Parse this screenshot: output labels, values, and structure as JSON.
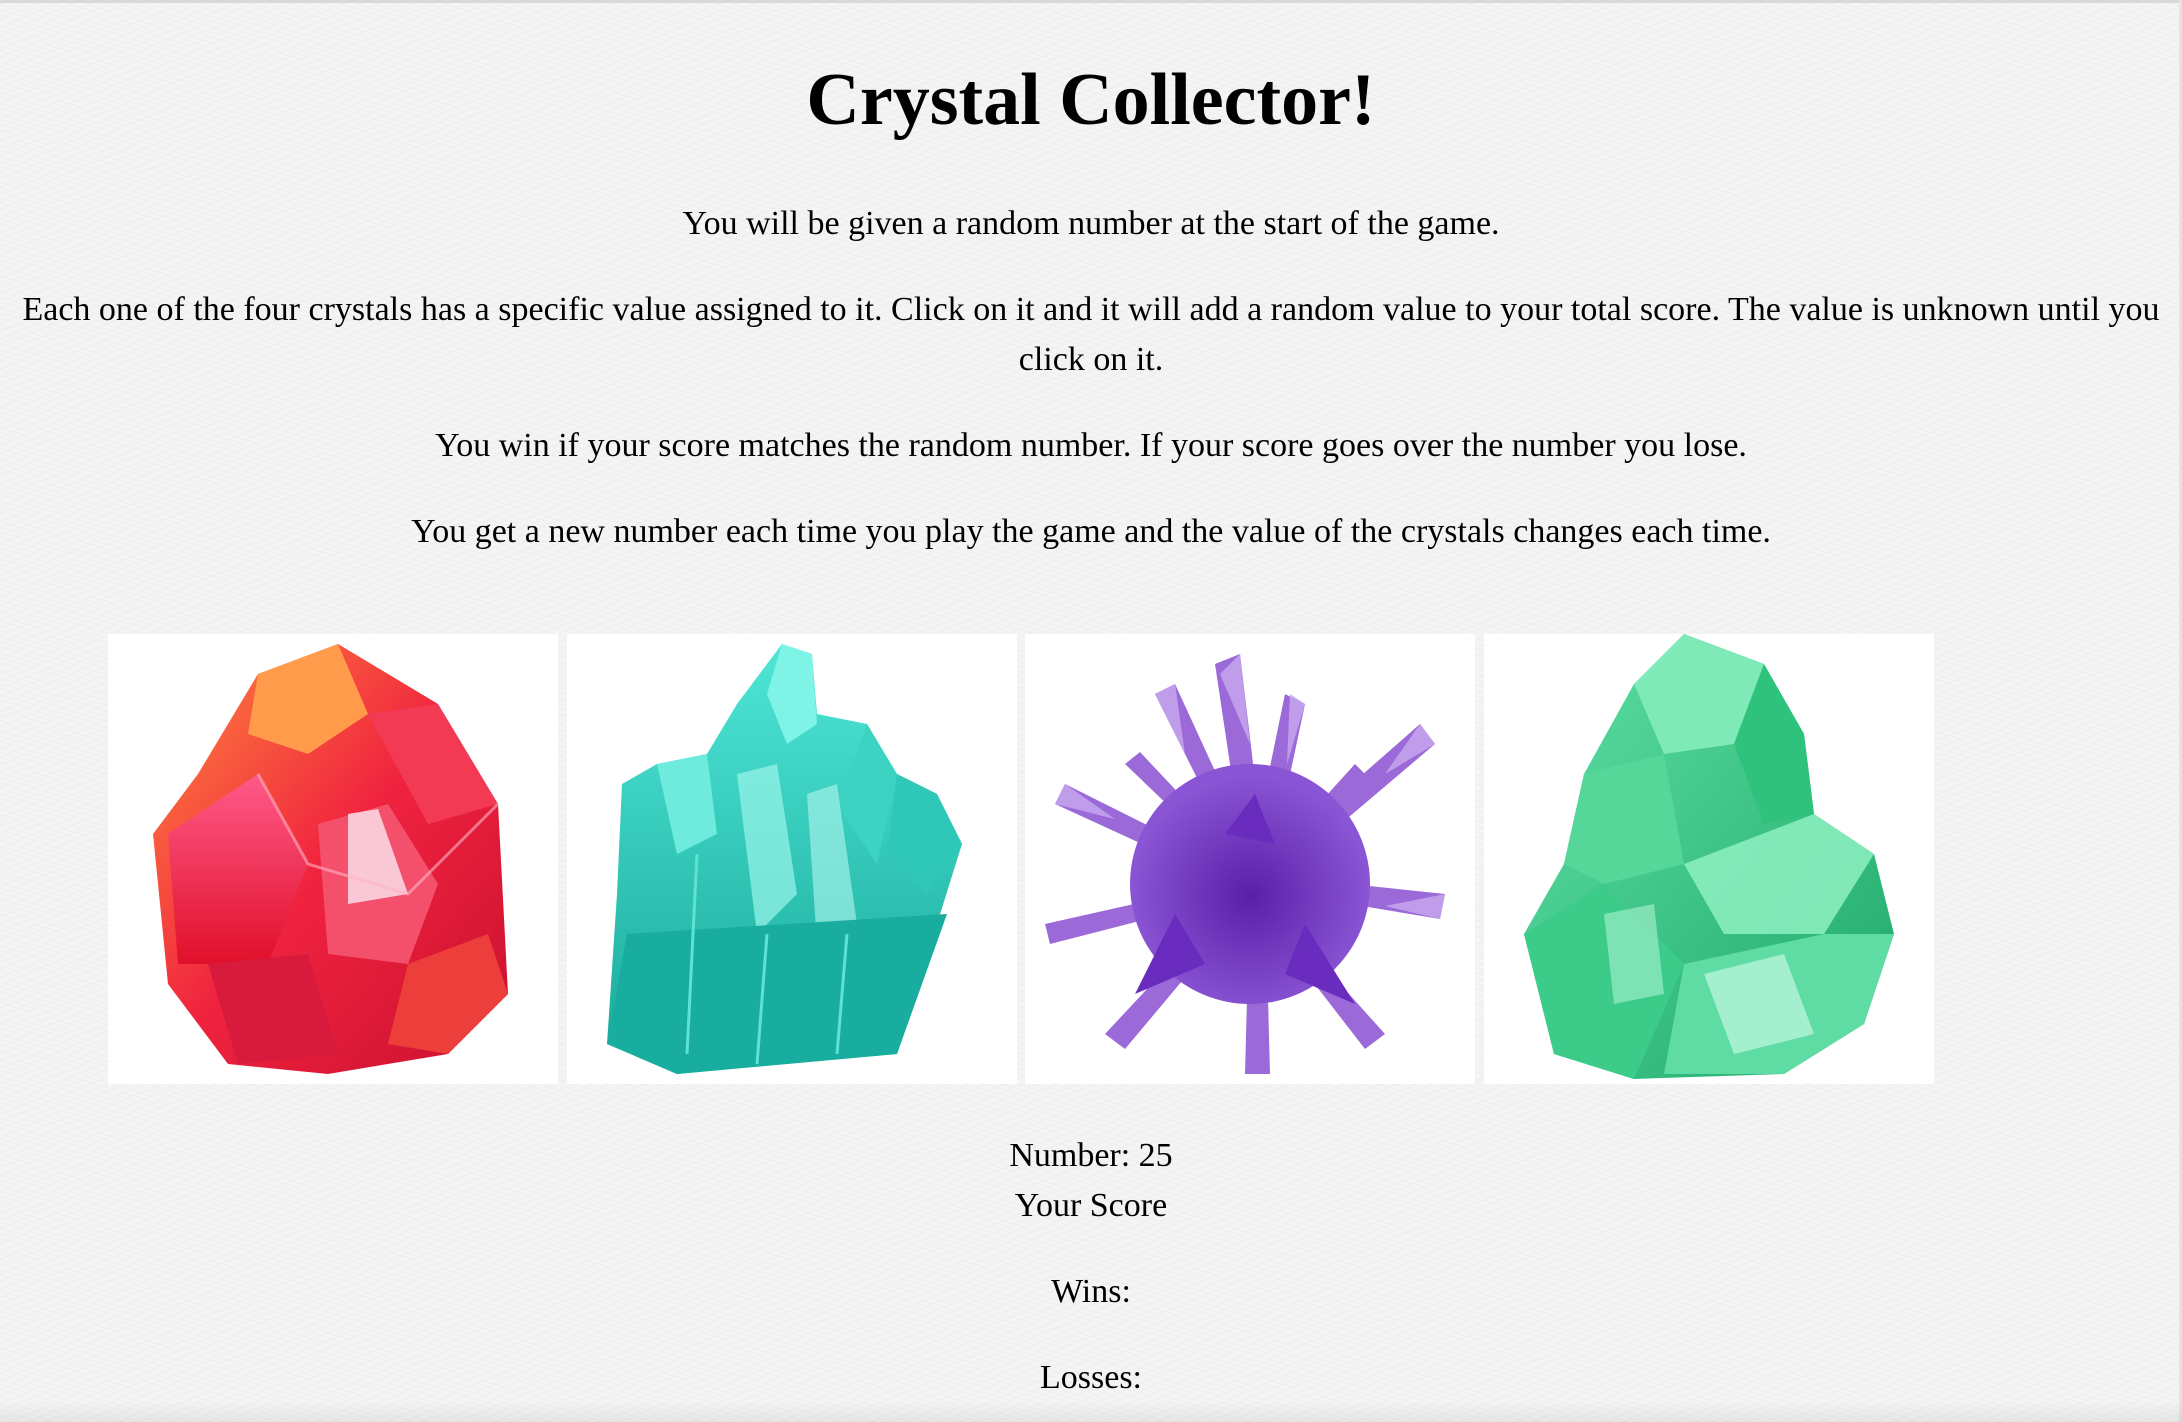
{
  "title": "Crystal Collector!",
  "instructions": [
    "You will be given a random number at the start of the game.",
    "Each one of the four crystals has a specific value assigned to it. Click on it and it will add a random value to your total score. The value is unknown until you click on it.",
    "You win if your score matches the random number. If your score goes over the number you lose.",
    "You get a new number each time you play the game and the value of the crystals changes each time."
  ],
  "crystals": [
    {
      "icon": "red-crystal",
      "color": "#e8203a"
    },
    {
      "icon": "teal-crystal",
      "color": "#2cc4b8"
    },
    {
      "icon": "purple-crystal",
      "color": "#7a3fc0"
    },
    {
      "icon": "green-crystal",
      "color": "#3fcf8e"
    }
  ],
  "stats": {
    "number_label": "Number: 25",
    "score_label": "Your Score",
    "wins_label": "Wins:",
    "losses_label": "Losses:"
  }
}
